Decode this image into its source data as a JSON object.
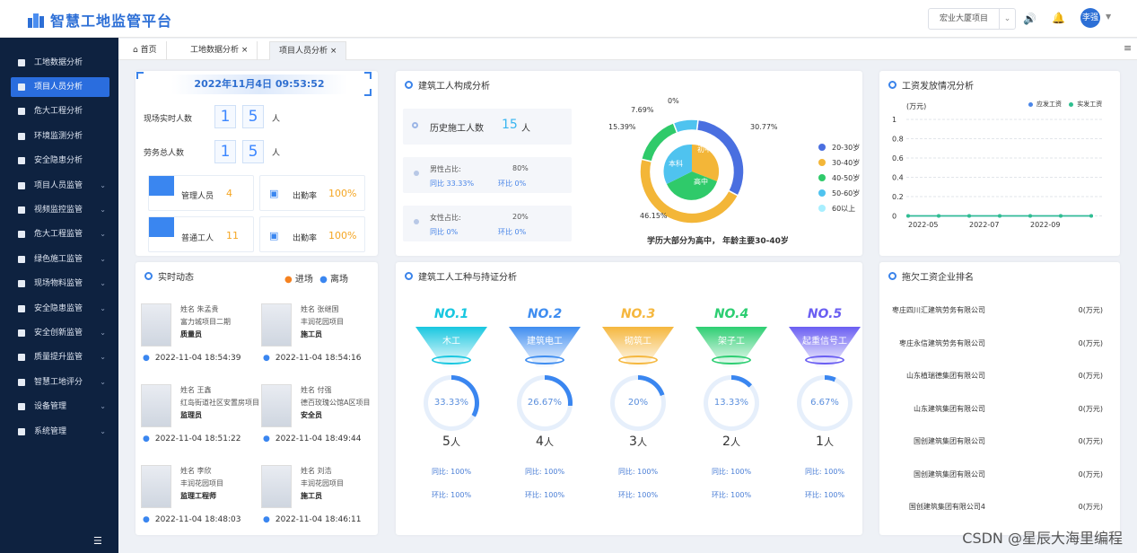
{
  "app": {
    "title": "智慧工地监管平台",
    "project_select": "宏业大厦项目",
    "user": "李强"
  },
  "sidebar": {
    "items": [
      {
        "label": "工地数据分析",
        "active": false,
        "expandable": false
      },
      {
        "label": "项目人员分析",
        "active": true,
        "expandable": false
      },
      {
        "label": "危大工程分析",
        "active": false,
        "expandable": false
      },
      {
        "label": "环境监测分析",
        "active": false,
        "expandable": false
      },
      {
        "label": "安全隐患分析",
        "active": false,
        "expandable": false
      },
      {
        "label": "项目人员监管",
        "active": false,
        "expandable": true
      },
      {
        "label": "视频监控监管",
        "active": false,
        "expandable": true
      },
      {
        "label": "危大工程监管",
        "active": false,
        "expandable": true
      },
      {
        "label": "绿色施工监管",
        "active": false,
        "expandable": true
      },
      {
        "label": "现场物料监管",
        "active": false,
        "expandable": true
      },
      {
        "label": "安全隐患监管",
        "active": false,
        "expandable": true
      },
      {
        "label": "安全创新监管",
        "active": false,
        "expandable": true
      },
      {
        "label": "质量提升监管",
        "active": false,
        "expandable": true
      },
      {
        "label": "智慧工地评分",
        "active": false,
        "expandable": true
      },
      {
        "label": "设备管理",
        "active": false,
        "expandable": true
      },
      {
        "label": "系统管理",
        "active": false,
        "expandable": true
      }
    ]
  },
  "tabs": [
    {
      "label": "首页"
    },
    {
      "label": "工地数据分析"
    },
    {
      "label": "项目人员分析"
    }
  ],
  "overview": {
    "datetime": "2022年11月4日 09:53:52",
    "onsite_label": "现场实时人数",
    "onsite_digits": [
      "1",
      "5"
    ],
    "unit": "人",
    "labor_label": "劳务总人数",
    "labor_digits": [
      "1",
      "5"
    ],
    "mgmt_label": "管理人员",
    "mgmt_value": "4",
    "attend_label": "出勤率",
    "attend_value1": "100%",
    "worker_label": "普通工人",
    "worker_value": "11",
    "attend_value2": "100%"
  },
  "composition": {
    "title": "建筑工人构成分析",
    "history_label": "历史施工人数",
    "history_value": "15",
    "history_unit": "人",
    "male_label": "男性占比:",
    "male_value": "80%",
    "male_yoy": "同比 33.33%",
    "male_mom": "环比 0%",
    "female_label": "女性占比:",
    "female_value": "20%",
    "female_yoy": "同比 0%",
    "female_mom": "环比 0%",
    "pct_labels": [
      "0%",
      "7.69%",
      "15.39%",
      "30.77%",
      "46.15%"
    ],
    "inner_labels": [
      "初中",
      "本科",
      "高中"
    ],
    "legend": [
      "20-30岁",
      "30-40岁",
      "40-50岁",
      "50-60岁",
      "60以上"
    ],
    "caption": "学历大部分为高中， 年龄主要30-40岁"
  },
  "chart_data": {
    "type": "donut",
    "age_groups": [
      {
        "name": "20-30岁",
        "value": 30.77,
        "color": "#4a6fe0"
      },
      {
        "name": "30-40岁",
        "value": 46.15,
        "color": "#f3b638"
      },
      {
        "name": "40-50岁",
        "value": 15.39,
        "color": "#2fca6a"
      },
      {
        "name": "50-60岁",
        "value": 7.69,
        "color": "#4fc3ef"
      },
      {
        "name": "60以上",
        "value": 0,
        "color": "#a8efff"
      }
    ]
  },
  "wages": {
    "title": "工资发放情况分析",
    "unit": "(万元)",
    "legend": [
      "应发工资",
      "实发工资"
    ],
    "yticks": [
      "1",
      "0.8",
      "0.6",
      "0.4",
      "0.2",
      "0"
    ],
    "xticks": [
      "2022-05",
      "2022-07",
      "2022-09"
    ],
    "chart_data": {
      "type": "line",
      "x": [
        "2022-04",
        "2022-05",
        "2022-06",
        "2022-07",
        "2022-08",
        "2022-09",
        "2022-10"
      ],
      "series": [
        {
          "name": "应发工资",
          "values": [
            0,
            0,
            0,
            0,
            0,
            0,
            0
          ]
        },
        {
          "name": "实发工资",
          "values": [
            0,
            0,
            0,
            0,
            0,
            0,
            0
          ]
        }
      ],
      "ylim": [
        0,
        1
      ]
    }
  },
  "live": {
    "title": "实时动态",
    "legend_in": "进场",
    "legend_out": "离场",
    "entries": [
      {
        "name": "姓名 朱孟贵",
        "project": "富力城项目二期",
        "role": "质量员",
        "time": "2022-11-04 18:54:39"
      },
      {
        "name": "姓名 张继国",
        "project": "丰润花园项目",
        "role": "施工员",
        "time": "2022-11-04 18:54:16"
      },
      {
        "name": "姓名 王鑫",
        "project": "红岛街道社区安置房项目",
        "role": "监理员",
        "time": "2022-11-04 18:51:22"
      },
      {
        "name": "姓名 付强",
        "project": "德百玫瑰公馆A区项目",
        "role": "安全员",
        "time": "2022-11-04 18:49:44"
      },
      {
        "name": "姓名 李欣",
        "project": "丰润花园项目",
        "role": "监理工程师",
        "time": "2022-11-04 18:48:03"
      },
      {
        "name": "姓名 刘浩",
        "project": "丰润花园项目",
        "role": "施工员",
        "time": "2022-11-04 18:46:11"
      }
    ]
  },
  "trades": {
    "title": "建筑工人工种与持证分析",
    "items": [
      {
        "rank": "NO.1",
        "name": "木工",
        "pct": "33.33%",
        "fill": 33.33,
        "count": "5",
        "yoy": "同比:  100%",
        "mom": "环比:  100%",
        "color": "#18c7e0"
      },
      {
        "rank": "NO.2",
        "name": "建筑电工",
        "pct": "26.67%",
        "fill": 26.67,
        "count": "4",
        "yoy": "同比:  100%",
        "mom": "环比:  100%",
        "color": "#3f8df0"
      },
      {
        "rank": "NO.3",
        "name": "砌筑工",
        "pct": "20%",
        "fill": 20,
        "count": "3",
        "yoy": "同比:  100%",
        "mom": "环比:  100%",
        "color": "#f5b73e"
      },
      {
        "rank": "NO.4",
        "name": "架子工",
        "pct": "13.33%",
        "fill": 13.33,
        "count": "2",
        "yoy": "同比:  100%",
        "mom": "环比:  100%",
        "color": "#2dce72"
      },
      {
        "rank": "NO.5",
        "name": "起重信号工",
        "pct": "6.67%",
        "fill": 6.67,
        "count": "1",
        "yoy": "同比:  100%",
        "mom": "环比:  100%",
        "color": "#6a5ef2"
      }
    ],
    "unit": "人"
  },
  "arrears": {
    "title": "拖欠工资企业排名",
    "rows": [
      {
        "name": "枣庄四川汇建筑劳务有限公司",
        "value": "0(万元)"
      },
      {
        "name": "枣庄永信建筑劳务有限公司",
        "value": "0(万元)"
      },
      {
        "name": "山东植瑞德集团有限公司",
        "value": "0(万元)"
      },
      {
        "name": "山东建筑集团有限公司",
        "value": "0(万元)"
      },
      {
        "name": "国创建筑集团有限公司",
        "value": "0(万元)"
      },
      {
        "name": "国创建筑集团有限公司",
        "value": "0(万元)"
      },
      {
        "name": "国创建筑集团有限公司4",
        "value": "0(万元)"
      }
    ]
  },
  "watermark": "CSDN @星辰大海里编程"
}
